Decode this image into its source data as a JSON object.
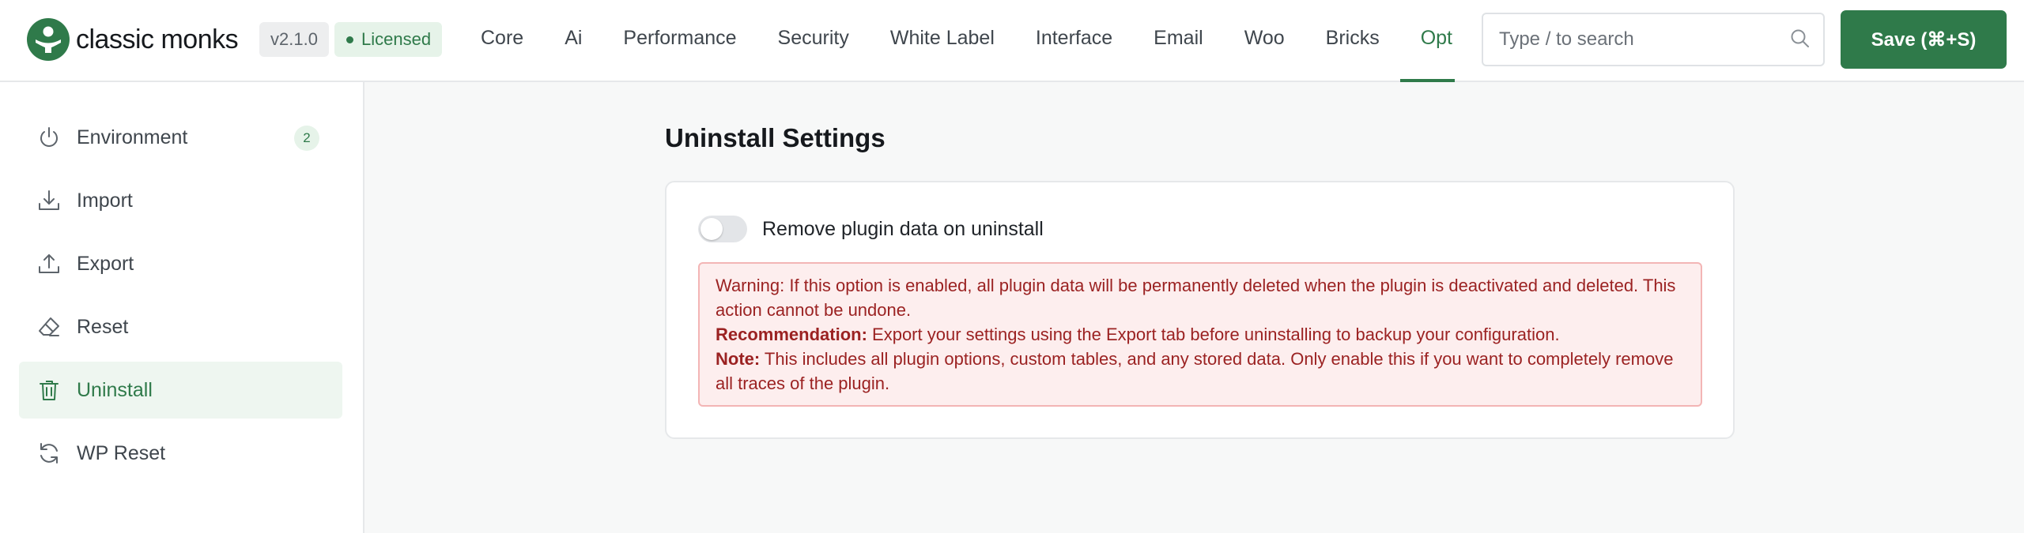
{
  "brand": {
    "name": "classic monks",
    "version": "v2.1.0",
    "license": "Licensed",
    "color": "#2f7a4a"
  },
  "nav": {
    "tabs": [
      {
        "label": "Core",
        "active": false
      },
      {
        "label": "Ai",
        "active": false
      },
      {
        "label": "Performance",
        "active": false
      },
      {
        "label": "Security",
        "active": false
      },
      {
        "label": "White Label",
        "active": false
      },
      {
        "label": "Interface",
        "active": false
      },
      {
        "label": "Email",
        "active": false
      },
      {
        "label": "Woo",
        "active": false
      },
      {
        "label": "Bricks",
        "active": false
      },
      {
        "label": "Opt",
        "active": true
      }
    ]
  },
  "search": {
    "placeholder": "Type / to search",
    "icon": "search-icon"
  },
  "toolbar": {
    "save_label": "Save (⌘+S)"
  },
  "sidebar": {
    "items": [
      {
        "label": "Environment",
        "icon": "power-icon",
        "badge": "2",
        "active": false
      },
      {
        "label": "Import",
        "icon": "download-icon",
        "active": false
      },
      {
        "label": "Export",
        "icon": "upload-icon",
        "active": false
      },
      {
        "label": "Reset",
        "icon": "eraser-icon",
        "active": false
      },
      {
        "label": "Uninstall",
        "icon": "trash-icon",
        "active": true
      },
      {
        "label": "WP Reset",
        "icon": "refresh-icon",
        "active": false
      }
    ]
  },
  "main": {
    "title": "Uninstall Settings",
    "toggle": {
      "label": "Remove plugin data on uninstall",
      "enabled": false
    },
    "warning": {
      "text": "Warning: If this option is enabled, all plugin data will be permanently deleted when the plugin is deactivated and deleted. This action cannot be undone.",
      "recommendation_label": "Recommendation:",
      "recommendation_text": " Export your settings using the Export tab before uninstalling to backup your configuration.",
      "note_label": "Note:",
      "note_text": " This includes all plugin options, custom tables, and any stored data. Only enable this if you want to completely remove all traces of the plugin."
    }
  }
}
